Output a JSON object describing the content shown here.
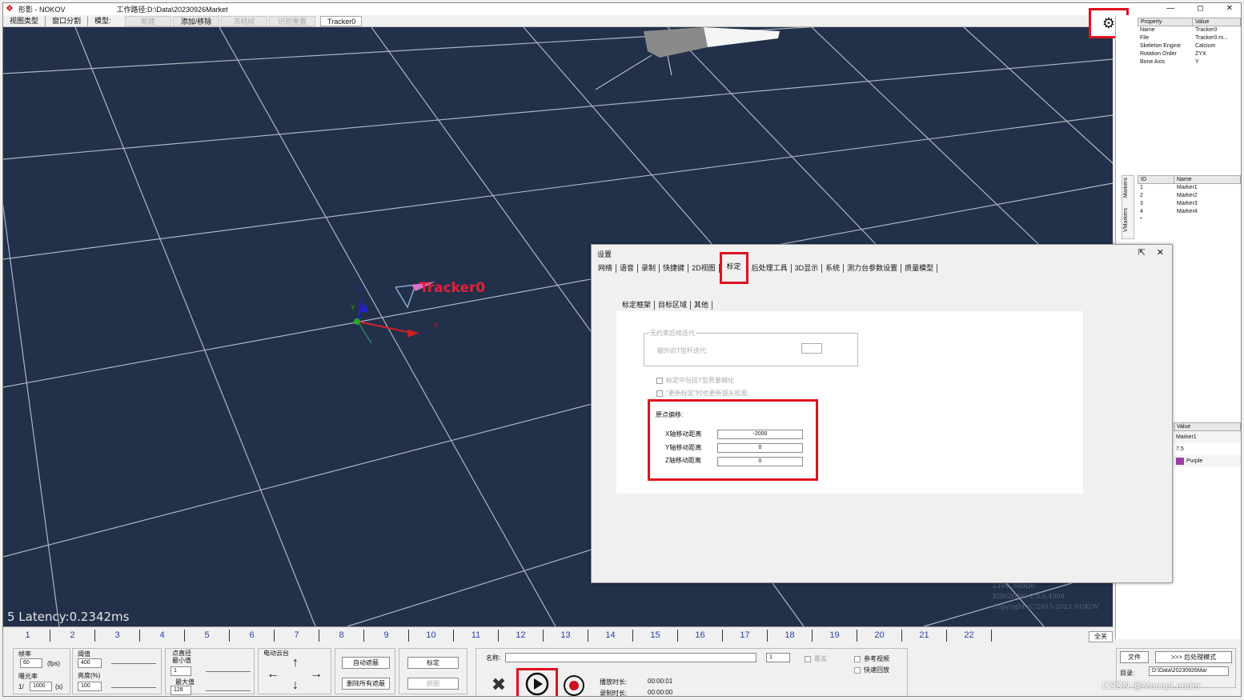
{
  "app": {
    "title": "形影 - NOKOV",
    "path": "工作路径:D:\\Data\\20230926Market",
    "ctrls": [
      "—",
      "◻",
      "✕"
    ]
  },
  "toolbar": {
    "view_type": "视图类型",
    "split": "窗口分割",
    "model": "模型:",
    "new": "新建",
    "addremove": "添加/移除",
    "freeze": "冻结帧",
    "identify": "识别重置",
    "tracker": "Tracker0"
  },
  "viewport": {
    "latency": "5 Latency:0.2342ms",
    "tracker_label": "Tracker0",
    "axis_x": "X",
    "axis_y": "Y",
    "axis_z": "Z",
    "watermark": [
      "Live Mode",
      "XINGYING 2.0.0.4908",
      "Copyright (C)2015-2023 NOKOV"
    ]
  },
  "properties": {
    "headers": [
      "Property",
      "Value"
    ],
    "rows": [
      [
        "Name",
        "Tracker0"
      ],
      [
        "File",
        "Tracker0.m..."
      ],
      [
        "Skeleton Engine",
        "Calcium"
      ],
      [
        "Rotation Order",
        "ZYX"
      ],
      [
        "Bone Axis",
        "Y"
      ]
    ]
  },
  "markers": {
    "headers": [
      "ID",
      "Name"
    ],
    "rows": [
      [
        "1",
        "Marker1"
      ],
      [
        "2",
        "Marker2"
      ],
      [
        "3",
        "Marker3"
      ],
      [
        "4",
        "Marker4"
      ],
      [
        "*",
        ""
      ]
    ],
    "tabs": [
      "Markers",
      "VMarkers"
    ]
  },
  "marker_props": {
    "header": "Value",
    "rows": [
      "Marker1",
      "7.5",
      "Purple"
    ],
    "color": "#9b3fa0"
  },
  "dialog": {
    "title": "设置",
    "tabs": [
      "网络",
      "语音",
      "录制",
      "快捷键",
      "2D视图",
      "标定",
      "后处理工具",
      "3D显示",
      "系统",
      "测力台参数设置",
      "质量模型"
    ],
    "active_tab": "标定",
    "subtabs": [
      "标定框架",
      "目标区域",
      "其他"
    ],
    "group_label": "无约束后续迭代",
    "group_field": "额外的T型杆迭代:",
    "chk1": "标定中包括T型质量细化",
    "chk2": "\"更新标定\"时也更新镜头校准:",
    "origin_label": "原点偏移:",
    "x_label": "X轴移动距离",
    "x_value": "-2000",
    "y_label": "Y轴移动距离",
    "y_value": "0",
    "z_label": "Z轴移动距离",
    "z_value": "0"
  },
  "status": {
    "numbers": [
      "1",
      "2",
      "3",
      "4",
      "5",
      "6",
      "7",
      "8",
      "9",
      "10",
      "11",
      "12",
      "13",
      "14",
      "15",
      "16",
      "17",
      "18",
      "19",
      "20",
      "21",
      "22"
    ],
    "all": "全关"
  },
  "bottom": {
    "fps_label": "帧率",
    "fps": "60",
    "fps_unit": "(fps)",
    "exposure_label": "曝光率",
    "exposure_prefix": "1/",
    "exposure": "1000",
    "exposure_unit": "(s)",
    "threshold_label": "阈值",
    "threshold": "400",
    "brightness_label": "亮度(%)",
    "brightness": "100",
    "point_label": "点直径",
    "min_label": "最小值",
    "min": "1",
    "max_label": "最大值",
    "max": "128",
    "ptz_label": "电动云台",
    "auto_mask": "自动遮蔽",
    "clear_mask": "删除所有遮蔽",
    "calibrate": "标定",
    "capture": "抓图",
    "name_label": "名称:",
    "frame": "1",
    "overwrite": "覆盖",
    "ref_video": "参考视频",
    "fast_playback": "快速回放",
    "play_time_label": "播放时长:",
    "play_time": "00:00:01",
    "rec_time_label": "录制时长:",
    "rec_time": "00:00:00",
    "file": "文件",
    "post_mode": ">>> 后处理模式",
    "dir_label": "目录:",
    "dir": "D:\\Data\\20230926Mar"
  },
  "watermark": "CSDN @MocapLeader"
}
